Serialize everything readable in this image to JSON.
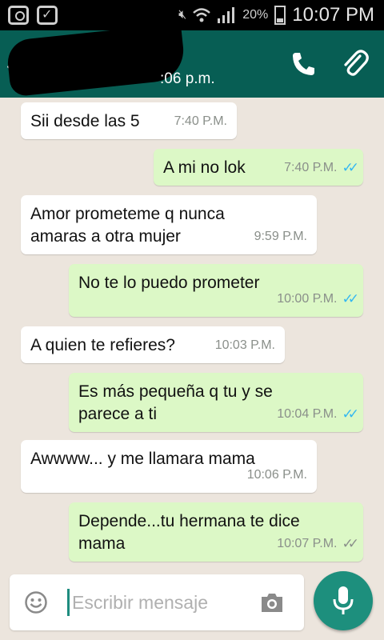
{
  "status_bar": {
    "battery": "20%",
    "time": "10:07 PM"
  },
  "header": {
    "last_seen": ":06 p.m."
  },
  "messages": [
    {
      "dir": "in",
      "text": "Sii desde las 5",
      "time": "7:40 P.M.",
      "ticks": ""
    },
    {
      "dir": "out",
      "text": "A mi no lok",
      "time": "7:40 P.M.",
      "ticks": "blue"
    },
    {
      "dir": "in",
      "text": "Amor prometeme q nunca\namaras a otra mujer",
      "time": "9:59 P.M.",
      "ticks": ""
    },
    {
      "dir": "out",
      "text": "No te lo puedo prometer",
      "time": "10:00 P.M.",
      "ticks": "blue"
    },
    {
      "dir": "in",
      "text": "A quien te refieres?",
      "time": "10:03 P.M.",
      "ticks": ""
    },
    {
      "dir": "out",
      "text": "Es más pequeña q tu y se\nparece a ti",
      "time": "10:04 P.M.",
      "ticks": "blue"
    },
    {
      "dir": "in",
      "text": "Awwww... y me llamara mama",
      "time": "10:06 P.M.",
      "ticks": ""
    },
    {
      "dir": "out",
      "text": "Depende...tu hermana te dice\nmama",
      "time": "10:07 P.M.",
      "ticks": "grey"
    }
  ],
  "input": {
    "placeholder": "Escribir mensaje"
  },
  "icons": {
    "status_left": [
      "instagram-icon",
      "briefcase-check-icon"
    ],
    "status_right": [
      "mute-icon",
      "wifi-icon",
      "signal-icon",
      "battery-icon"
    ],
    "header": [
      "back-arrow-icon",
      "phone-icon",
      "paperclip-icon"
    ],
    "input": [
      "emoji-icon",
      "camera-icon",
      "mic-icon"
    ]
  },
  "colors": {
    "header": "#075e54",
    "outgoing_bubble": "#dcf8c6",
    "incoming_bubble": "#ffffff",
    "read_ticks": "#34b7f1",
    "mic_button": "#1d8f7d"
  }
}
